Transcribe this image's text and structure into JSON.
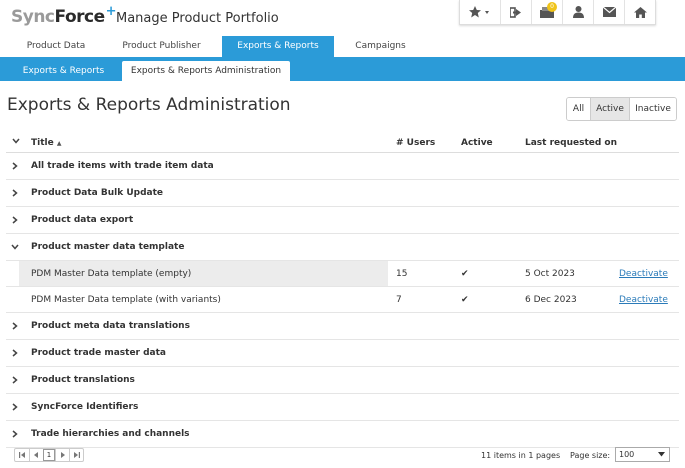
{
  "header": {
    "logo_sync": "Sync",
    "logo_force": "Force",
    "logo_plus": "+",
    "app_title": "Manage Product Portfolio",
    "notification_count": "0"
  },
  "main_tabs": [
    {
      "label": "Product Data"
    },
    {
      "label": "Product Publisher"
    },
    {
      "label": "Exports & Reports"
    },
    {
      "label": "Campaigns"
    }
  ],
  "sub_tabs": [
    {
      "label": "Exports & Reports"
    },
    {
      "label": "Exports & Reports Administration"
    }
  ],
  "page": {
    "title": "Exports & Reports Administration",
    "filters": [
      "All",
      "Active",
      "Inactive"
    ],
    "active_filter": "Active"
  },
  "table": {
    "columns": {
      "title": "Title",
      "users": "# Users",
      "active": "Active",
      "last_requested": "Last requested on"
    },
    "sort_indicator": "▲",
    "groups": [
      {
        "title": "All trade items with trade item data"
      },
      {
        "title": "Product Data Bulk Update"
      },
      {
        "title": "Product data export"
      },
      {
        "title": "Product master data template"
      },
      {
        "title": "Product meta data translations"
      },
      {
        "title": "Product trade master data"
      },
      {
        "title": "Product translations"
      },
      {
        "title": "SyncForce Identifiers"
      },
      {
        "title": "Trade hierarchies and channels"
      }
    ],
    "children": [
      {
        "title": "PDM Master Data template (empty)",
        "users": "15",
        "active": "✔",
        "date": "5 Oct 2023",
        "action": "Deactivate"
      },
      {
        "title": "PDM Master Data template (with variants)",
        "users": "7",
        "active": "✔",
        "date": "6 Dec 2023",
        "action": "Deactivate"
      }
    ]
  },
  "footer": {
    "current_page": "1",
    "items_info": "11 items in 1 pages",
    "page_size_label": "Page size:",
    "page_size": "100"
  }
}
